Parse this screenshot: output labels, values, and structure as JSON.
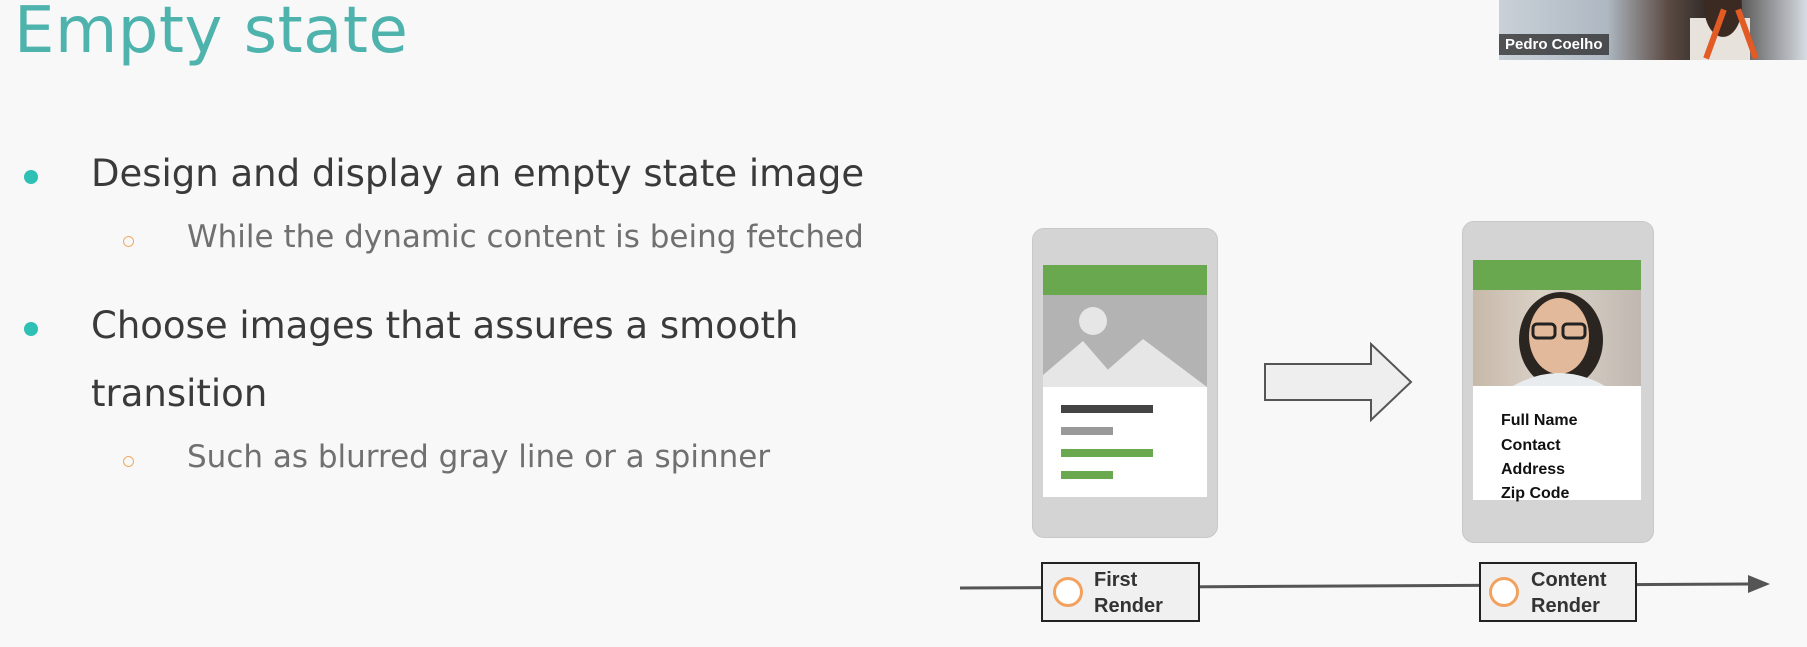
{
  "slide": {
    "title": "Empty state",
    "bullets": [
      {
        "text": "Design and display an empty state image",
        "sub": "While the dynamic content is being fetched"
      },
      {
        "text_line1": "Choose images that assures a smooth",
        "text_line2": "transition",
        "sub": "Such as blurred gray line or a spinner"
      }
    ]
  },
  "video": {
    "participant_name": "Pedro Coelho"
  },
  "diagram": {
    "phone_right_fields": [
      "Full Name",
      "Contact",
      "Address",
      "Zip Code"
    ],
    "timeline": [
      {
        "line1": "First",
        "line2": "Render"
      },
      {
        "line1": "Content",
        "line2": "Render"
      }
    ],
    "colors": {
      "accent_title": "#4fb3ad",
      "bullet": "#2ec0b4",
      "sub_bullet": "#f0a862",
      "header_green": "#6aa84f"
    }
  }
}
